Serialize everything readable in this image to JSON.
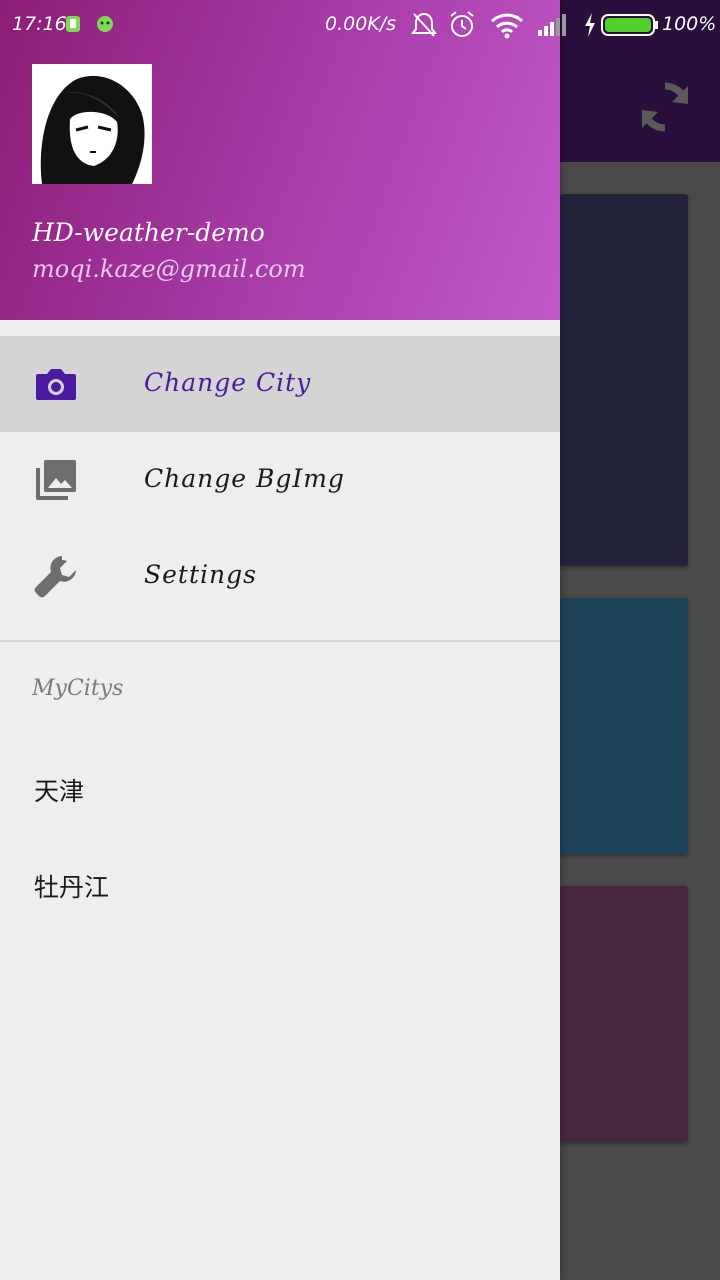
{
  "status_bar": {
    "time": "17:16",
    "net_speed": "0.00K/s",
    "battery_percent": "100%"
  },
  "app": {
    "refresh_icon": "refresh-icon",
    "card_colors": [
      "#22233a",
      "#1d4359",
      "#462641"
    ]
  },
  "drawer": {
    "header": {
      "name": "HD-weather-demo",
      "email": "moqi.kaze@gmail.com"
    },
    "menu": [
      {
        "label": "Change City",
        "icon": "camera-icon",
        "active": true
      },
      {
        "label": "Change BgImg",
        "icon": "photo-library-icon",
        "active": false
      },
      {
        "label": "Settings",
        "icon": "wrench-icon",
        "active": false
      }
    ],
    "section_title": "MyCitys",
    "cities": [
      "天津",
      "牡丹江"
    ]
  },
  "colors": {
    "accent": "#4a1aa0",
    "header_start": "#8c1d74",
    "header_end": "#c15ac9"
  }
}
